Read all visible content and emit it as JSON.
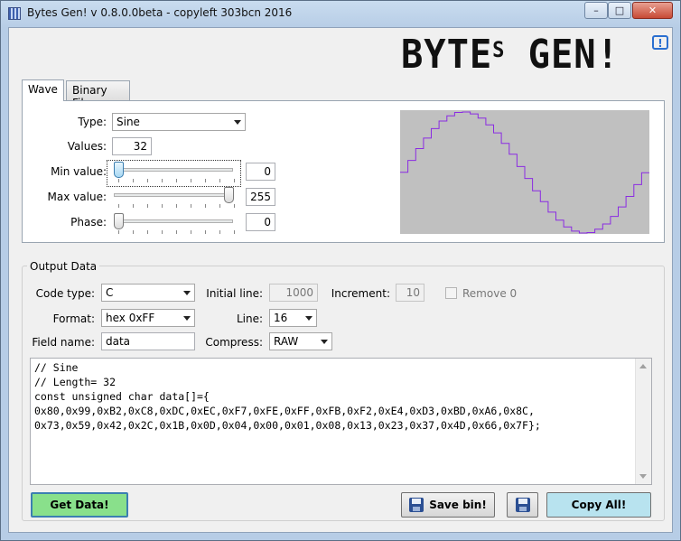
{
  "window": {
    "title": "Bytes Gen! v 0.8.0.0beta - copyleft 303bcn 2016",
    "min": "–",
    "max": "□",
    "close": "✕"
  },
  "logo": {
    "text": "BYTES GEN!",
    "help": "!"
  },
  "tabs": [
    {
      "label": "Wave",
      "active": true
    },
    {
      "label": "Binary File",
      "active": false
    }
  ],
  "wave": {
    "type_label": "Type:",
    "type_value": "Sine",
    "values_label": "Values:",
    "values_value": "32",
    "min_label": "Min value:",
    "min_value": "0",
    "min_fraction": 0.0,
    "max_label": "Max value:",
    "max_value": "255",
    "max_fraction": 1.0,
    "phase_label": "Phase:",
    "phase_value": "0",
    "phase_fraction": 0.0,
    "preview": {
      "background": "#c0c0c0",
      "line_color": "#8a2be2",
      "samples": [
        128,
        153,
        178,
        200,
        220,
        236,
        247,
        254,
        255,
        251,
        242,
        228,
        211,
        189,
        166,
        140,
        115,
        89,
        66,
        44,
        27,
        13,
        4,
        0,
        1,
        8,
        19,
        35,
        55,
        77,
        102,
        127
      ]
    }
  },
  "output": {
    "group_title": "Output Data",
    "code_type_label": "Code type:",
    "code_type_value": "C",
    "initial_line_label": "Initial line:",
    "initial_line_value": "1000",
    "increment_label": "Increment:",
    "increment_value": "10",
    "remove0_label": "Remove 0",
    "format_label": "Format:",
    "format_value": "hex 0xFF",
    "line_label": "Line:",
    "line_value": "16",
    "field_name_label": "Field name:",
    "field_name_value": "data",
    "compress_label": "Compress:",
    "compress_value": "RAW",
    "code_lines": [
      "// Sine",
      "// Length= 32",
      "const unsigned char data[]={",
      "0x80,0x99,0xB2,0xC8,0xDC,0xEC,0xF7,0xFE,0xFF,0xFB,0xF2,0xE4,0xD3,0xBD,0xA6,0x8C,",
      "0x73,0x59,0x42,0x2C,0x1B,0x0D,0x04,0x00,0x01,0x08,0x13,0x23,0x37,0x4D,0x66,0x7F};"
    ]
  },
  "buttons": {
    "get_data": "Get Data!",
    "save_bin": "Save bin!",
    "copy_all": "Copy All!"
  }
}
